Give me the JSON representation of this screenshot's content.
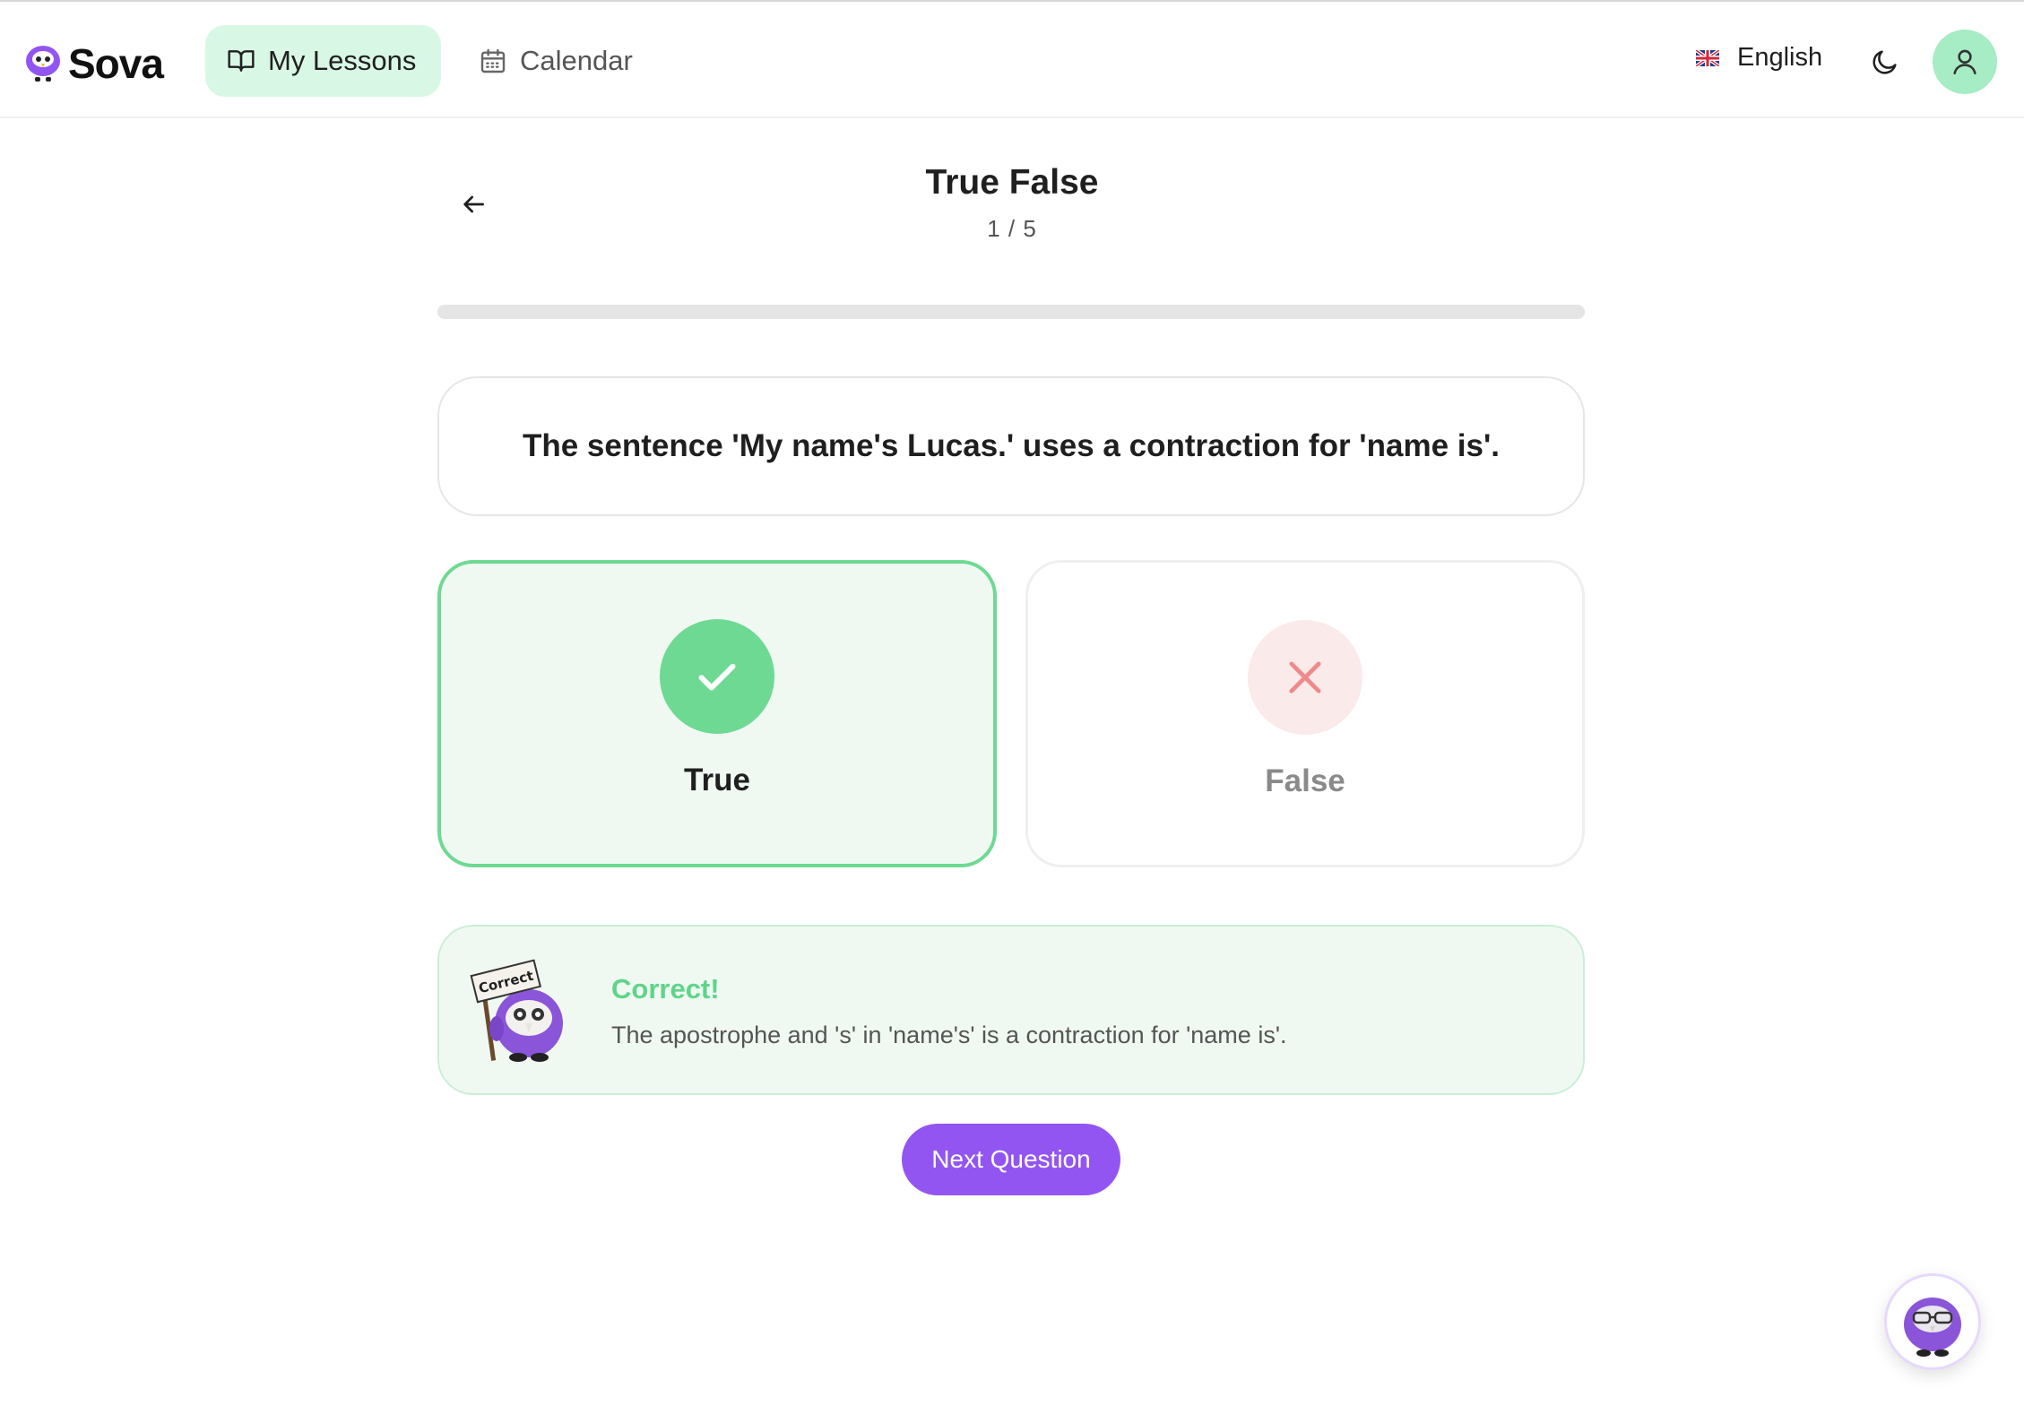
{
  "brand": {
    "name": "Sova"
  },
  "nav": {
    "lessons_label": "My Lessons",
    "calendar_label": "Calendar"
  },
  "header": {
    "language_label": "English"
  },
  "quiz": {
    "title": "True False",
    "counter": "1 / 5",
    "progress_fraction": 0.0,
    "question": "The sentence 'My name's Lucas.' uses a contraction for 'name is'.",
    "options": [
      {
        "label": "True",
        "state": "selected-correct"
      },
      {
        "label": "False",
        "state": "unselected"
      }
    ]
  },
  "feedback": {
    "title": "Correct!",
    "explanation": "The apostrophe and 's' in 'name's' is a contraction for 'name is'.",
    "mascot_sign": "Correct"
  },
  "actions": {
    "next_label": "Next Question"
  },
  "colors": {
    "accent_green": "#6ed993",
    "accent_purple": "#9355f2",
    "nav_active_bg": "#d9f7e5",
    "error_soft": "#fbeaea"
  },
  "icons": {
    "logo": "owl-logo-icon",
    "lessons": "book-open-icon",
    "calendar": "calendar-icon",
    "flag": "uk-flag-icon",
    "theme": "moon-icon",
    "avatar": "user-icon",
    "back": "arrow-left-icon",
    "true": "check-icon",
    "false": "x-icon",
    "chat": "owl-assistant-icon"
  }
}
